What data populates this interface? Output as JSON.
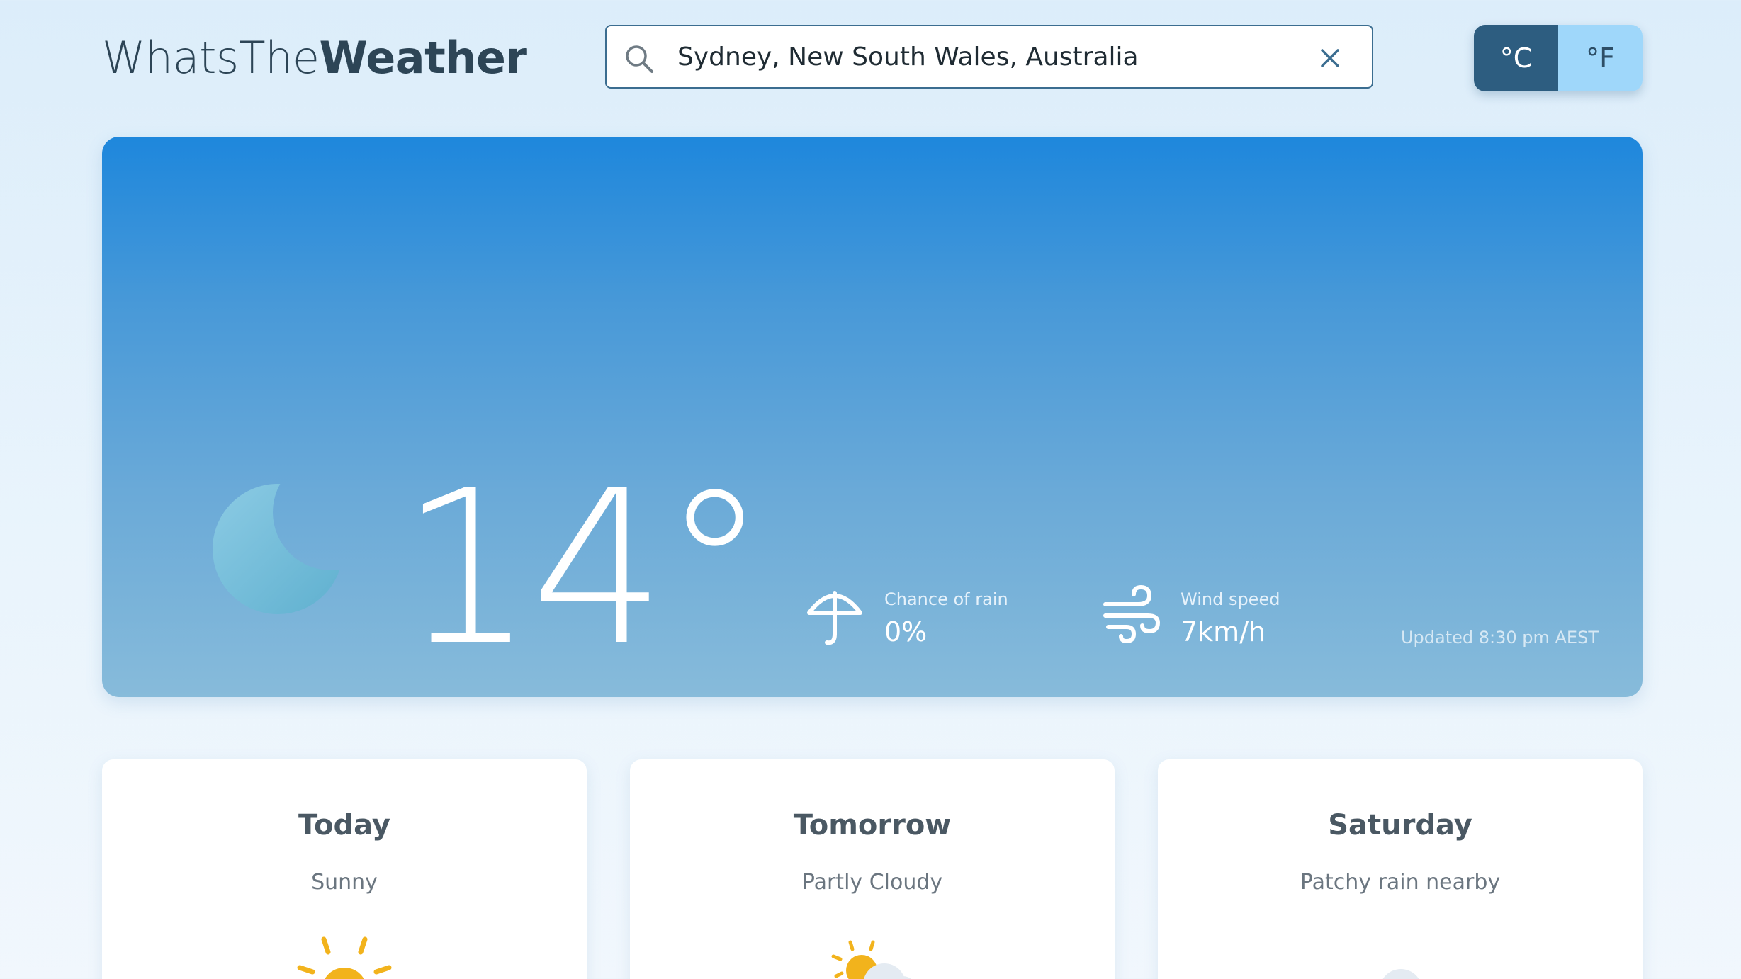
{
  "app": {
    "logo_light": "WhatsThe",
    "logo_bold": "Weather"
  },
  "search": {
    "value": "Sydney, New South Wales, Australia",
    "icon": "search-icon",
    "clear_icon": "close-icon"
  },
  "units": {
    "celsius": "°C",
    "fahrenheit": "°F",
    "selected": "°C"
  },
  "current": {
    "condition_icon": "moon-icon",
    "temperature": "14°",
    "rain_label": "Chance of rain",
    "rain_value": "0%",
    "rain_icon": "umbrella-icon",
    "wind_label": "Wind speed",
    "wind_value": "7km/h",
    "wind_icon": "wind-icon",
    "updated": "Updated 8:30 pm AEST"
  },
  "forecast": [
    {
      "day": "Today",
      "condition": "Sunny",
      "icon": "sun-icon"
    },
    {
      "day": "Tomorrow",
      "condition": "Partly Cloudy",
      "icon": "partly-cloudy-icon"
    },
    {
      "day": "Saturday",
      "condition": "Patchy rain nearby",
      "icon": "cloud-rain-icon"
    }
  ],
  "colors": {
    "accent_dark": "#2d5d80",
    "accent_light": "#9fd7fa",
    "hero_top": "#1e87dc",
    "hero_bottom": "#87bbda",
    "text_dark": "#2d4556",
    "sun": "#f2b31c"
  }
}
